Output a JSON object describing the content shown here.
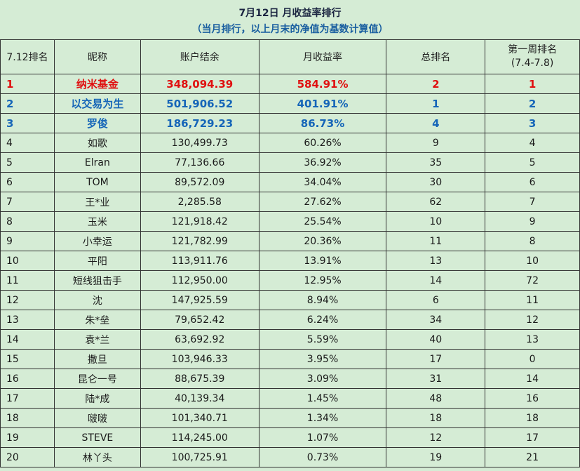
{
  "title": "7月12日 月收益率排行",
  "subtitle": "（当月排行，以上月末的净值为基数计算值）",
  "headers": {
    "rank": "7.12排名",
    "nickname": "昵称",
    "balance": "账户结余",
    "monthly_return": "月收益率",
    "total_rank": "总排名",
    "week1_rank_line1": "第一周排名",
    "week1_rank_line2": "(7.4-7.8)"
  },
  "colors": {
    "background": "#d5ecd5",
    "top1": "#e01010",
    "top2_3": "#1565b8",
    "grid": "#333333"
  },
  "rows": [
    {
      "rank": "1",
      "name": "纳米基金",
      "balance": "348,094.39",
      "ret": "584.91%",
      "total": "2",
      "week1": "1"
    },
    {
      "rank": "2",
      "name": "以交易为生",
      "balance": "501,906.52",
      "ret": "401.91%",
      "total": "1",
      "week1": "2"
    },
    {
      "rank": "3",
      "name": "罗俊",
      "balance": "186,729.23",
      "ret": "86.73%",
      "total": "4",
      "week1": "3"
    },
    {
      "rank": "4",
      "name": "如歌",
      "balance": "130,499.73",
      "ret": "60.26%",
      "total": "9",
      "week1": "4"
    },
    {
      "rank": "5",
      "name": "Elran",
      "balance": "77,136.66",
      "ret": "36.92%",
      "total": "35",
      "week1": "5"
    },
    {
      "rank": "6",
      "name": "TOM",
      "balance": "89,572.09",
      "ret": "34.04%",
      "total": "30",
      "week1": "6"
    },
    {
      "rank": "7",
      "name": "王*业",
      "balance": "2,285.58",
      "ret": "27.62%",
      "total": "62",
      "week1": "7"
    },
    {
      "rank": "8",
      "name": "玉米",
      "balance": "121,918.42",
      "ret": "25.54%",
      "total": "10",
      "week1": "9"
    },
    {
      "rank": "9",
      "name": "小幸运",
      "balance": "121,782.99",
      "ret": "20.36%",
      "total": "11",
      "week1": "8"
    },
    {
      "rank": "10",
      "name": "平阳",
      "balance": "113,911.76",
      "ret": "13.91%",
      "total": "13",
      "week1": "10"
    },
    {
      "rank": "11",
      "name": "短线狙击手",
      "balance": "112,950.00",
      "ret": "12.95%",
      "total": "14",
      "week1": "72"
    },
    {
      "rank": "12",
      "name": "沈",
      "balance": "147,925.59",
      "ret": "8.94%",
      "total": "6",
      "week1": "11"
    },
    {
      "rank": "13",
      "name": "朱*垒",
      "balance": "79,652.42",
      "ret": "6.24%",
      "total": "34",
      "week1": "12"
    },
    {
      "rank": "14",
      "name": "袁*兰",
      "balance": "63,692.92",
      "ret": "5.59%",
      "total": "40",
      "week1": "13"
    },
    {
      "rank": "15",
      "name": "撒旦",
      "balance": "103,946.33",
      "ret": "3.95%",
      "total": "17",
      "week1": "0"
    },
    {
      "rank": "16",
      "name": "昆仑一号",
      "balance": "88,675.39",
      "ret": "3.09%",
      "total": "31",
      "week1": "14"
    },
    {
      "rank": "17",
      "name": "陆*成",
      "balance": "40,139.34",
      "ret": "1.45%",
      "total": "48",
      "week1": "16"
    },
    {
      "rank": "18",
      "name": "啵啵",
      "balance": "101,340.71",
      "ret": "1.34%",
      "total": "18",
      "week1": "18"
    },
    {
      "rank": "19",
      "name": "STEVE",
      "balance": "114,245.00",
      "ret": "1.07%",
      "total": "12",
      "week1": "17"
    },
    {
      "rank": "20",
      "name": "林丫头",
      "balance": "100,725.91",
      "ret": "0.73%",
      "total": "19",
      "week1": "21"
    }
  ]
}
